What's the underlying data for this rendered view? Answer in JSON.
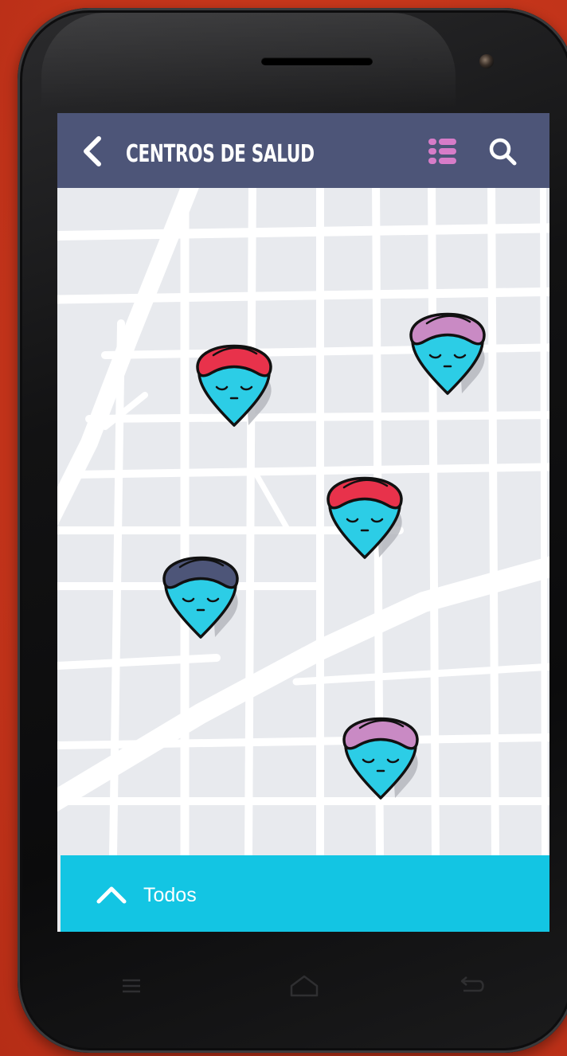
{
  "app": {
    "title": "CENTROS DE SALUD",
    "bottom_filter_label": "Todos"
  },
  "header": {
    "back_icon": "chevron-left-icon",
    "list_icon": "list-icon",
    "search_icon": "search-icon"
  },
  "map": {
    "markers": [
      {
        "name": "map-marker-red-1",
        "cap_color": "#e8324b"
      },
      {
        "name": "map-marker-purple-1",
        "cap_color": "#c98ac4"
      },
      {
        "name": "map-marker-red-2",
        "cap_color": "#e8324b"
      },
      {
        "name": "map-marker-navy",
        "cap_color": "#4d5578"
      },
      {
        "name": "map-marker-purple-2",
        "cap_color": "#c98ac4"
      }
    ]
  },
  "colors": {
    "accent": "#13c5e3",
    "appbar": "#4d5578",
    "list_icon": "#d77cc8",
    "marker_face": "#2ccde6",
    "background": "#c9371a"
  },
  "system_nav": {
    "menu_icon": "menu-icon",
    "home_icon": "home-icon",
    "back_icon": "back-arrow-icon"
  }
}
